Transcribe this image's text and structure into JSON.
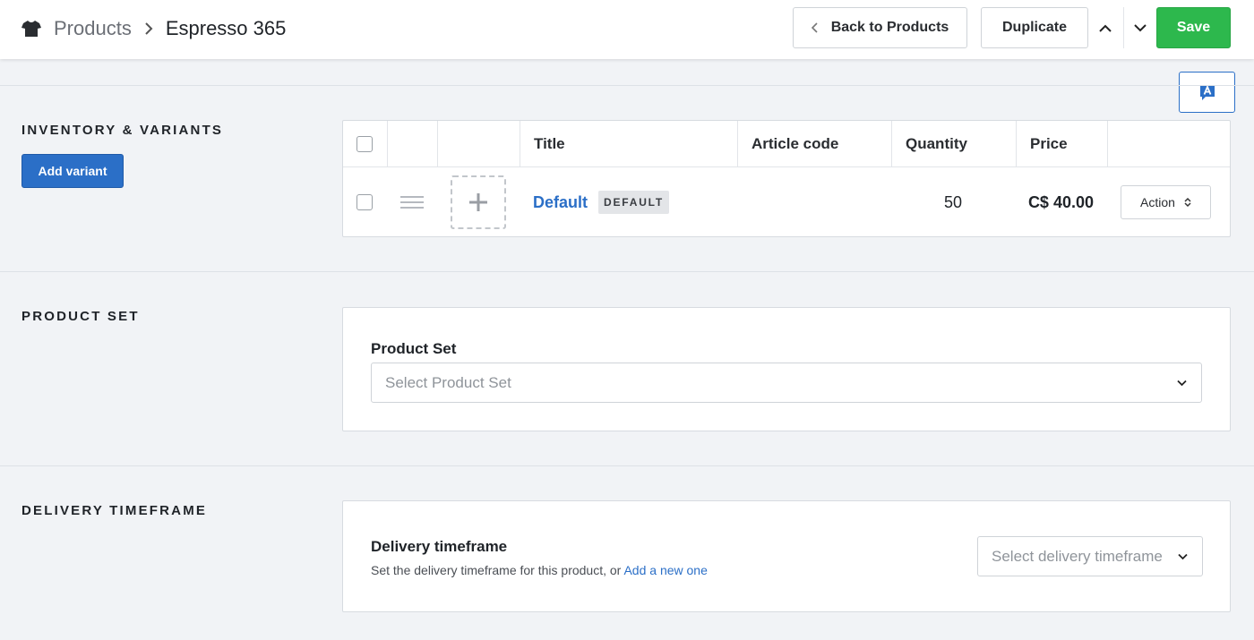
{
  "header": {
    "breadcrumb_parent": "Products",
    "breadcrumb_current": "Espresso 365",
    "back_label": "Back to Products",
    "duplicate_label": "Duplicate",
    "save_label": "Save",
    "icons": [
      "tshirt-icon",
      "chevron-right-icon",
      "chevron-left-icon",
      "chevron-up-icon",
      "chevron-down-icon",
      "translate-icon"
    ]
  },
  "inventory": {
    "section_title": "INVENTORY & VARIANTS",
    "add_variant_label": "Add variant",
    "columns": [
      "Title",
      "Article code",
      "Quantity",
      "Price"
    ],
    "rows": [
      {
        "title": "Default",
        "badge": "DEFAULT",
        "article_code": "",
        "quantity": "50",
        "price": "C$ 40.00",
        "action_label": "Action"
      }
    ]
  },
  "product_set": {
    "section_title": "PRODUCT SET",
    "field_label": "Product Set",
    "placeholder": "Select Product Set"
  },
  "delivery": {
    "section_title": "DELIVERY TIMEFRAME",
    "field_label": "Delivery timeframe",
    "help_text": "Set the delivery timeframe for this product, or",
    "help_link": "Add a new one",
    "placeholder": "Select delivery timeframe"
  },
  "colors": {
    "primary": "#2b6fc7",
    "save": "#2db84d",
    "background": "#f1f3f6"
  }
}
